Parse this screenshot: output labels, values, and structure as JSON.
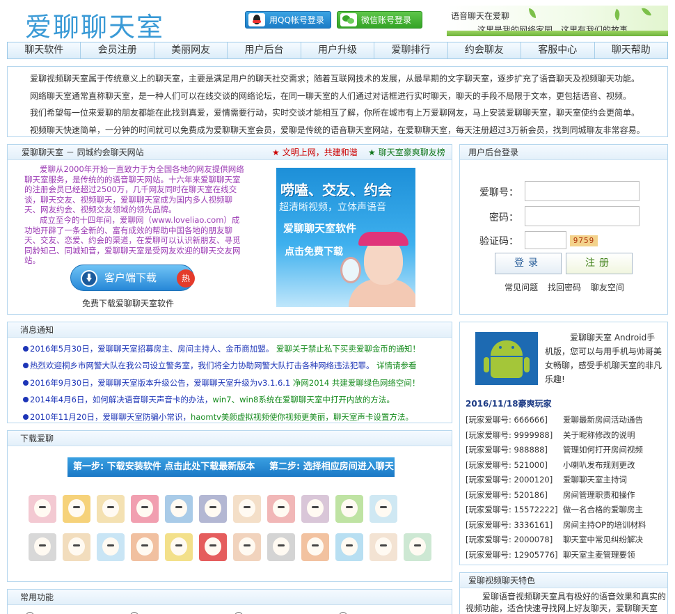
{
  "header": {
    "logo": "爱聊聊天室",
    "qq_login": "用QQ帐号登录",
    "wechat_login": "微信账号登录",
    "banner_line1": "语音聊天在爱聊",
    "banner_line2": "这里是我的网络家园，这里有我们的故事……"
  },
  "nav": [
    "聊天软件",
    "会员注册",
    "美丽网友",
    "用户后台",
    "用户升级",
    "爱聊排行",
    "约会聊友",
    "客服中心",
    "聊天帮助"
  ],
  "intro": [
    "爱聊视频聊天室属于传统意义上的聊天室，主要是满足用户的聊天社交需求；随着互联网技术的发展，从最早期的文字聊天室，逐步扩充了语音聊天及视频聊天功能。",
    "网络聊天室通常直称聊天室，是一种人们可以在线交谈的网络论坛，在同一聊天室的人们通过对话框进行实时聊天，聊天的手段不局限于文本，更包括语音、视频。",
    "我们希望每一位来爱聊的朋友都能在此找到真爱，爱情需要行动，实时交谈才能相互了解，你所在城市有上万爱聊网友，马上安装爱聊聊天室，聊天室使约会更简单。",
    "视频聊天快速简单，一分钟的时间就可以免费成为爱聊聊天室会员，爱聊是传统的语音聊天室网站，在爱聊聊天室，每天注册超过3万新会员，找到同城聊友非常容易。"
  ],
  "about": {
    "title": "爱聊聊天室 － 同城约会聊天网站",
    "link1": "文明上网，共建和谐",
    "link2": "聊天室豪爽聊友榜",
    "para1": "爱聊从2000年开始一直致力于为全国各地的网友提供网络聊天室服务，是传统的的语音聊天网站。十六年来爱聊聊天室的注册会员已经超过2500万，几千网友同时在聊天室在线交谈，聊天交友、视频聊天，爱聊聊天室成为国内多人视频聊天、网友约会、视频交友领域的领先品牌。",
    "para2": "成立至今的十四年间，爱聊网（www.loveliao.com）成功地开辟了一条全新的、富有成效的帮助中国各地的朋友聊天、交友、恋爱、约会的渠道，在爱聊可以认识新朋友、寻觅同龄知己、同城知音，爱聊聊天室是受网友欢迎的聊天交友网站。",
    "download_button": "客户端下载",
    "hot_badge": "热",
    "download_caption": "免费下载爱聊聊天室软件",
    "promo_line1": "唠嗑、交友、约会",
    "promo_line2": "超清晰视频，立体声语音",
    "promo_line3": "爱聊聊天室软件",
    "promo_line4": "点击免费下载"
  },
  "login": {
    "title": "用户后台登录",
    "id_label": "爱聊号：",
    "pwd_label": "密码：",
    "captcha_label": "验证码：",
    "captcha_value": "9759",
    "login_button": "登录",
    "register_button": "注册",
    "links": [
      "常见问题",
      "找回密码",
      "聊友空间"
    ]
  },
  "notice": {
    "title": "消息通知",
    "items": [
      {
        "blue": "2016年5月30日，爱聊聊天室招募房主、房间主持人、金币商加盟。",
        "green": "爱聊关于禁止私下买卖爱聊金币的通知！"
      },
      {
        "blue": "热烈欢迎桐乡市网警大队在我公司设立警务室，我们将全力协助网警大队打击各种网络违法犯罪。",
        "green": "详情请参看"
      },
      {
        "blue": "2016年9月30日，爱聊聊天室版本升级公告，爱聊聊天室升级为v3.1.6.1",
        "green": "净网2014 共建爱聊绿色网络空间！"
      },
      {
        "blue": "2014年4月6日，如何解决语音聊天声音卡的办法，",
        "green": "win7、win8系统在爱聊聊天室中打开内放的方法。"
      },
      {
        "blue": "2010年11月20日，爱聊聊天室防骗小常识，",
        "green": "haomtv美颜虚拟视频使你视频更美丽，聊天室声卡设置方法。"
      }
    ]
  },
  "android": {
    "text": "爱聊聊天室 Android手机版，您可以与用手机与帅哥美女畅聊，感受手机聊天室的非凡乐趣!",
    "players_title": "2016/11/18豪爽玩家",
    "players": [
      {
        "id": "[玩家爱聊号: 666666]",
        "topic": "爱聊最新房间活动通告"
      },
      {
        "id": "[玩家爱聊号: 9999988]",
        "topic": "关于昵称修改的说明"
      },
      {
        "id": "[玩家爱聊号: 988888]",
        "topic": "管理如何打开房间视频"
      },
      {
        "id": "[玩家爱聊号: 521000]",
        "topic": "小喇叭发布规则更改"
      },
      {
        "id": "[玩家爱聊号: 2000120]",
        "topic": "爱聊聊天室主持词"
      },
      {
        "id": "[玩家爱聊号: 520186]",
        "topic": "房间管理职责和操作"
      },
      {
        "id": "[玩家爱聊号: 15572222]",
        "topic": "做一名合格的爱聊房主"
      },
      {
        "id": "[玩家爱聊号: 3336161]",
        "topic": "房间主持OP的培训材料"
      },
      {
        "id": "[玩家爱聊号: 2000078]",
        "topic": "聊天室中常见纠纷解决"
      },
      {
        "id": "[玩家爱聊号: 12905776]",
        "topic": "聊天室主麦管理要领"
      }
    ]
  },
  "download": {
    "title": "下载爱聊",
    "step1": "第一步: 下载安装软件 点击此处下载最新版本",
    "step2": "第二步: 选择相应房间进入聊天",
    "emoji_colors": [
      "#f3c9d2",
      "#f6d27a",
      "#f4e1b2",
      "#f19fb0",
      "#a9cbe8",
      "#b3b7d3",
      "#f4dfc8",
      "#f1b7b7",
      "#d9c6d8",
      "#bfe3a3",
      "#cfe8f3",
      "#d8d8d8",
      "#f2ddbd",
      "#c9e5f5",
      "#f1c0a0",
      "#f3e08a",
      "#e55d5d",
      "#f1d3bd",
      "#d4d4d4",
      "#f2c2a0",
      "#b8dff2",
      "#f3e3d3",
      "#cde8d3"
    ]
  },
  "features": {
    "title": "爱聊视频聊天特色",
    "text": "爱聊语音视频聊天室具有极好的语音效果和真实的视频功能，适合快速寻找网上好友聊天，爱聊聊天室"
  },
  "common": {
    "title": "常用功能"
  }
}
